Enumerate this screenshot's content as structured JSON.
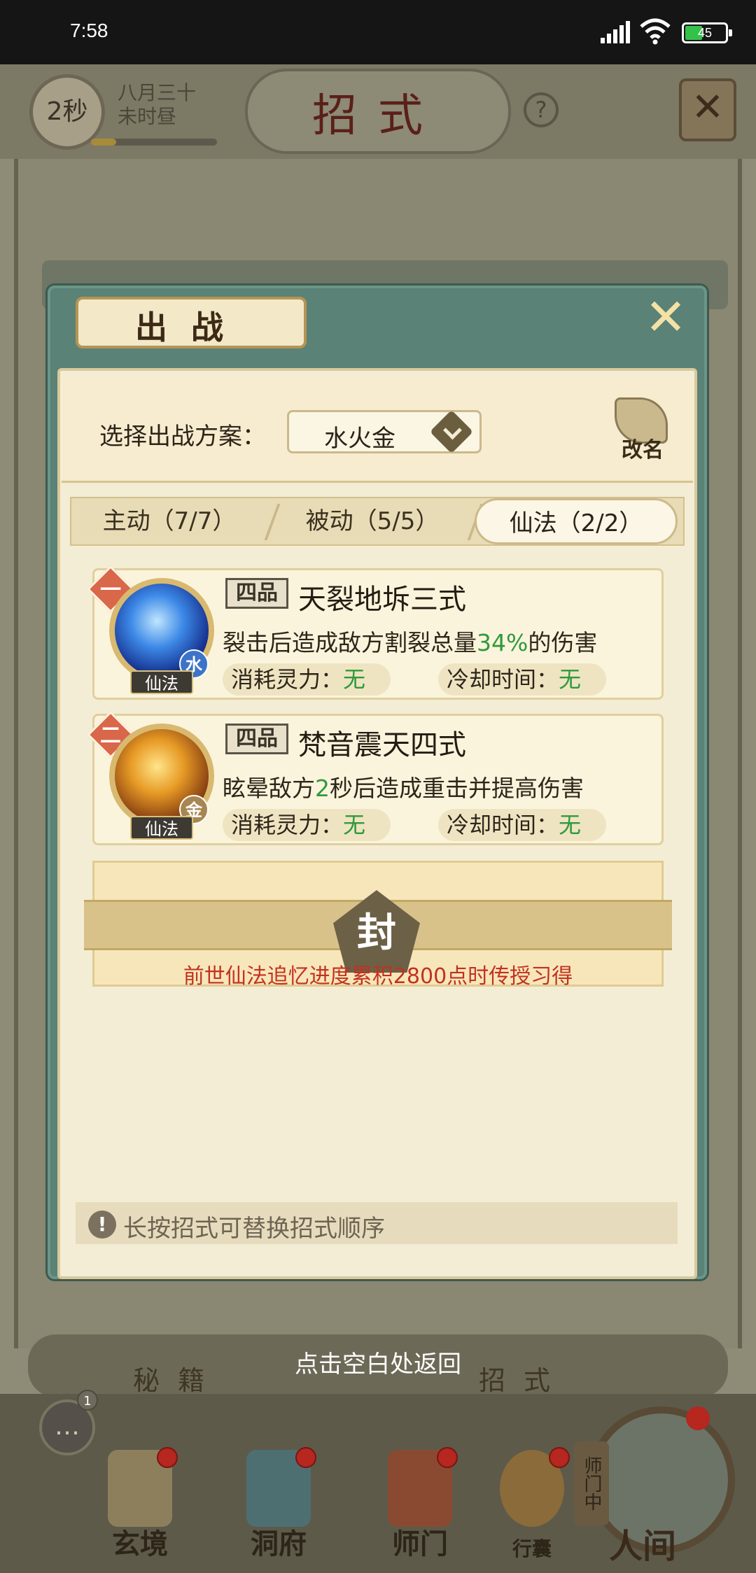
{
  "status_bar": {
    "time": "7:58",
    "battery": "45",
    "battery_level": 0.45
  },
  "background": {
    "timer_label": "2秒",
    "date_line1": "八月三十",
    "date_line2": "未时昼",
    "page_title": "招式",
    "help_label": "?",
    "return_hint": "点击空白处返回",
    "bottom_tabs": [
      "秘籍",
      "招式"
    ],
    "chat_badge": "1",
    "nav": [
      "玄境",
      "洞府",
      "师门",
      "行囊"
    ],
    "world_label": "人间",
    "world_side": "师门中"
  },
  "modal": {
    "title": "出战",
    "scheme_label": "选择出战方案：",
    "scheme_value": "水火金",
    "rename_label": "改名",
    "tabs": [
      {
        "label": "主动（7/7）"
      },
      {
        "label": "被动（5/5）"
      },
      {
        "label": "仙法（2/2）"
      }
    ],
    "active_tab": "仙法（2/2）",
    "skills": [
      {
        "rank": "一",
        "grade": "四品",
        "name": "天裂地坼三式",
        "desc_prefix": "裂击后造成敌方割裂总量",
        "desc_highlight": "34%",
        "desc_suffix": "的伤害",
        "element": "水",
        "type_tag": "仙法",
        "cost_label": "消耗灵力：",
        "cost_value": "无",
        "cooldown_label": "冷却时间：",
        "cooldown_value": "无",
        "icon": "water-skill-icon"
      },
      {
        "rank": "二",
        "grade": "四品",
        "name": "梵音震天四式",
        "desc_prefix": "眩晕敌方",
        "desc_highlight": "2",
        "desc_suffix": "秒后造成重击并提高伤害",
        "element": "金",
        "type_tag": "仙法",
        "cost_label": "消耗灵力：",
        "cost_value": "无",
        "cooldown_label": "冷却时间：",
        "cooldown_value": "无",
        "icon": "music-skill-icon"
      }
    ],
    "locked_slot": {
      "seal_label": "封",
      "hint": "前世仙法追忆进度累积2800点时传授习得"
    },
    "tip": "长按招式可替换招式顺序"
  },
  "colors": {
    "modal_frame": "#5a8276",
    "highlight_green": "#2e9a3c",
    "warning_red": "#c1321f",
    "rank_badge": "#d9674a"
  }
}
